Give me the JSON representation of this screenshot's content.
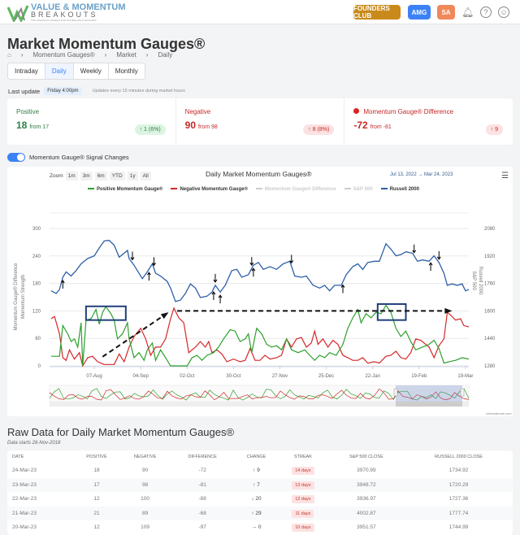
{
  "header": {
    "logo_line1": "VALUE & MOMENTUM",
    "logo_line2": "BREAKOUTS",
    "logo_tagline": "TOP FINANCIAL MODELS FOR DOUBLE-DIGIT SUCCESS",
    "founders": "FOUNDERS CLUB",
    "amg": "AMG",
    "sa": "SA",
    "colors": {
      "founders": "#c98a1b",
      "amg": "#3b82f6",
      "sa": "#f0885a"
    }
  },
  "page": {
    "title": "Market Momentum Gauges®",
    "breadcrumb": [
      "Momentum Gauges®",
      "Market",
      "Daily"
    ],
    "tabs": [
      "Intraday",
      "Daily",
      "Weekly",
      "Monthly"
    ],
    "active_tab": "Daily"
  },
  "update": {
    "label": "Last update",
    "time": "Friday 4:00pm",
    "note": "Updates every 15 minutes during market hours"
  },
  "cards": [
    {
      "label": "Positive",
      "value": "18",
      "from": "from 17",
      "change": "↑ 1 (6%)",
      "color": "#2e7d46"
    },
    {
      "label": "Negative",
      "value": "90",
      "from": "from 98",
      "change": "↑ 8 (8%)",
      "color": "#c62828"
    },
    {
      "label": "Momentum Gauge® Difference",
      "value": "-72",
      "from": "from -81",
      "change": "↑ 9",
      "color": "#c62828"
    }
  ],
  "toggle": {
    "label": "Momentum Gauge® Signal Changes",
    "on": true
  },
  "chart_controls": {
    "zoom_label": "Zoom",
    "zoom": [
      "1m",
      "3m",
      "6m",
      "YTD",
      "1y",
      "All"
    ],
    "from": "Jul 13, 2022",
    "to": "Mar 24, 2023",
    "sep": "→"
  },
  "credit": "vmbreakouts.com",
  "chart_data": {
    "type": "line",
    "title": "Daily Market Momentum Gauges®",
    "legend": [
      {
        "name": "Positive Momentum Gauge®",
        "color": "#2ca02c",
        "visible": true
      },
      {
        "name": "Negative Momentum Gauge®",
        "color": "#d62728",
        "visible": true
      },
      {
        "name": "Momentum Gauge® Difference",
        "color": "#ccc",
        "visible": false
      },
      {
        "name": "S&P 500",
        "color": "#ccc",
        "visible": false
      },
      {
        "name": "Russell 2000",
        "color": "#2e5fa8",
        "visible": true
      }
    ],
    "ylabel_left": "Momentum Gauge® Difference",
    "ylabel_left2": "Momentum Strength",
    "ylabel_right": "S&P 500",
    "ylabel_right2": "Russell 2000",
    "ylim_left": [
      0,
      300
    ],
    "yticks_left": [
      "0",
      "60",
      "120",
      "180",
      "240",
      "300"
    ],
    "ylim_right": [
      1280,
      2080
    ],
    "yticks_right": [
      "1280",
      "1440",
      "1600",
      "1760",
      "1920",
      "2080"
    ],
    "x_unit": "days since Jul 12, 2022",
    "xlim": [
      -1,
      252
    ],
    "xticks": [
      {
        "d": 26,
        "label": "07-Aug"
      },
      {
        "d": 54,
        "label": "04-Sep"
      },
      {
        "d": 82,
        "label": "02-Oct"
      },
      {
        "d": 110,
        "label": "30-Oct"
      },
      {
        "d": 138,
        "label": "27-Nov"
      },
      {
        "d": 166,
        "label": "25-Dec"
      },
      {
        "d": 194,
        "label": "22-Jan"
      },
      {
        "d": 222,
        "label": "19-Feb"
      },
      {
        "d": 250,
        "label": "19-Mar"
      }
    ],
    "russell": [
      [
        0,
        1717
      ],
      [
        3,
        1702
      ],
      [
        5,
        1725
      ],
      [
        7,
        1796
      ],
      [
        9,
        1827
      ],
      [
        12,
        1803
      ],
      [
        15,
        1835
      ],
      [
        18,
        1874
      ],
      [
        22,
        1905
      ],
      [
        26,
        1921
      ],
      [
        29,
        1967
      ],
      [
        32,
        2007
      ],
      [
        35,
        2011
      ],
      [
        38,
        1983
      ],
      [
        41,
        1913
      ],
      [
        44,
        1936
      ],
      [
        46,
        1952
      ],
      [
        47,
        1905
      ],
      [
        50,
        1866
      ],
      [
        55,
        1788
      ],
      [
        58,
        1827
      ],
      [
        61,
        1874
      ],
      [
        63,
        1819
      ],
      [
        66,
        1803
      ],
      [
        70,
        1772
      ],
      [
        72,
        1733
      ],
      [
        75,
        1655
      ],
      [
        78,
        1663
      ],
      [
        81,
        1702
      ],
      [
        84,
        1757
      ],
      [
        87,
        1733
      ],
      [
        90,
        1678
      ],
      [
        94,
        1686
      ],
      [
        97,
        1710
      ],
      [
        99,
        1749
      ],
      [
        102,
        1710
      ],
      [
        105,
        1749
      ],
      [
        109,
        1835
      ],
      [
        112,
        1842
      ],
      [
        115,
        1796
      ],
      [
        119,
        1811
      ],
      [
        122,
        1866
      ],
      [
        125,
        1882
      ],
      [
        128,
        1842
      ],
      [
        132,
        1858
      ],
      [
        136,
        1842
      ],
      [
        140,
        1874
      ],
      [
        144,
        1889
      ],
      [
        147,
        1803
      ],
      [
        151,
        1796
      ],
      [
        154,
        1803
      ],
      [
        158,
        1749
      ],
      [
        162,
        1733
      ],
      [
        165,
        1749
      ],
      [
        168,
        1717
      ],
      [
        171,
        1749
      ],
      [
        175,
        1749
      ],
      [
        178,
        1811
      ],
      [
        182,
        1858
      ],
      [
        185,
        1874
      ],
      [
        188,
        1842
      ],
      [
        191,
        1882
      ],
      [
        195,
        1889
      ],
      [
        198,
        1889
      ],
      [
        202,
        1991
      ],
      [
        205,
        1960
      ],
      [
        208,
        1921
      ],
      [
        211,
        1928
      ],
      [
        214,
        1944
      ],
      [
        218,
        1936
      ],
      [
        221,
        1889
      ],
      [
        224,
        1897
      ],
      [
        228,
        1889
      ],
      [
        231,
        1921
      ],
      [
        234,
        1882
      ],
      [
        237,
        1819
      ],
      [
        239,
        1749
      ],
      [
        242,
        1757
      ],
      [
        245,
        1749
      ],
      [
        248,
        1757
      ],
      [
        250,
        1717
      ],
      [
        252,
        1725
      ]
    ],
    "positive": [
      [
        0,
        21
      ],
      [
        5,
        21
      ],
      [
        7,
        88
      ],
      [
        10,
        70
      ],
      [
        12,
        53
      ],
      [
        14,
        59
      ],
      [
        16,
        41
      ],
      [
        18,
        94
      ],
      [
        19,
        0
      ],
      [
        21,
        100
      ],
      [
        24,
        103
      ],
      [
        27,
        123
      ],
      [
        29,
        91
      ],
      [
        31,
        117
      ],
      [
        33,
        129
      ],
      [
        36,
        114
      ],
      [
        38,
        100
      ],
      [
        40,
        59
      ],
      [
        43,
        70
      ],
      [
        46,
        94
      ],
      [
        47,
        59
      ],
      [
        50,
        18
      ],
      [
        53,
        29
      ],
      [
        56,
        12
      ],
      [
        58,
        35
      ],
      [
        61,
        50
      ],
      [
        63,
        12
      ],
      [
        66,
        35
      ],
      [
        70,
        12
      ],
      [
        72,
        0
      ],
      [
        78,
        0
      ],
      [
        82,
        0
      ],
      [
        85,
        18
      ],
      [
        88,
        23
      ],
      [
        91,
        12
      ],
      [
        94,
        23
      ],
      [
        98,
        29
      ],
      [
        101,
        41
      ],
      [
        104,
        59
      ],
      [
        108,
        79
      ],
      [
        111,
        76
      ],
      [
        114,
        53
      ],
      [
        117,
        59
      ],
      [
        119,
        70
      ],
      [
        121,
        29
      ],
      [
        124,
        82
      ],
      [
        127,
        70
      ],
      [
        130,
        47
      ],
      [
        133,
        41
      ],
      [
        136,
        44
      ],
      [
        139,
        35
      ],
      [
        142,
        59
      ],
      [
        145,
        35
      ],
      [
        149,
        29
      ],
      [
        153,
        35
      ],
      [
        156,
        23
      ],
      [
        159,
        12
      ],
      [
        162,
        23
      ],
      [
        165,
        18
      ],
      [
        168,
        29
      ],
      [
        172,
        23
      ],
      [
        176,
        47
      ],
      [
        179,
        82
      ],
      [
        182,
        105
      ],
      [
        185,
        123
      ],
      [
        187,
        94
      ],
      [
        190,
        114
      ],
      [
        193,
        105
      ],
      [
        196,
        117
      ],
      [
        199,
        114
      ],
      [
        202,
        132
      ],
      [
        205,
        117
      ],
      [
        208,
        82
      ],
      [
        211,
        64
      ],
      [
        214,
        76
      ],
      [
        217,
        53
      ],
      [
        220,
        35
      ],
      [
        224,
        41
      ],
      [
        228,
        47
      ],
      [
        231,
        56
      ],
      [
        234,
        38
      ],
      [
        237,
        6
      ],
      [
        240,
        9
      ],
      [
        244,
        12
      ],
      [
        248,
        18
      ],
      [
        252,
        15
      ]
    ],
    "negative": [
      [
        0,
        103
      ],
      [
        2,
        108
      ],
      [
        5,
        70
      ],
      [
        7,
        18
      ],
      [
        9,
        12
      ],
      [
        11,
        35
      ],
      [
        14,
        15
      ],
      [
        17,
        29
      ],
      [
        19,
        0
      ],
      [
        22,
        18
      ],
      [
        25,
        21
      ],
      [
        28,
        9
      ],
      [
        32,
        3
      ],
      [
        38,
        3
      ],
      [
        41,
        26
      ],
      [
        44,
        9
      ],
      [
        47,
        41
      ],
      [
        50,
        64
      ],
      [
        54,
        82
      ],
      [
        57,
        59
      ],
      [
        60,
        23
      ],
      [
        63,
        41
      ],
      [
        66,
        41
      ],
      [
        69,
        59
      ],
      [
        72,
        103
      ],
      [
        74,
        126
      ],
      [
        77,
        105
      ],
      [
        80,
        94
      ],
      [
        83,
        29
      ],
      [
        87,
        41
      ],
      [
        90,
        53
      ],
      [
        93,
        41
      ],
      [
        95,
        53
      ],
      [
        97,
        29
      ],
      [
        100,
        35
      ],
      [
        103,
        26
      ],
      [
        106,
        9
      ],
      [
        110,
        15
      ],
      [
        114,
        9
      ],
      [
        117,
        12
      ],
      [
        120,
        38
      ],
      [
        123,
        12
      ],
      [
        126,
        12
      ],
      [
        129,
        23
      ],
      [
        132,
        15
      ],
      [
        136,
        18
      ],
      [
        139,
        23
      ],
      [
        142,
        59
      ],
      [
        145,
        41
      ],
      [
        148,
        59
      ],
      [
        151,
        62
      ],
      [
        154,
        41
      ],
      [
        157,
        50
      ],
      [
        159,
        76
      ],
      [
        161,
        47
      ],
      [
        164,
        59
      ],
      [
        167,
        41
      ],
      [
        170,
        56
      ],
      [
        173,
        47
      ],
      [
        176,
        23
      ],
      [
        179,
        18
      ],
      [
        182,
        12
      ],
      [
        185,
        12
      ],
      [
        188,
        18
      ],
      [
        191,
        6
      ],
      [
        195,
        9
      ],
      [
        198,
        6
      ],
      [
        202,
        21
      ],
      [
        205,
        23
      ],
      [
        208,
        32
      ],
      [
        211,
        18
      ],
      [
        214,
        15
      ],
      [
        217,
        29
      ],
      [
        220,
        59
      ],
      [
        223,
        56
      ],
      [
        226,
        47
      ],
      [
        228,
        41
      ],
      [
        231,
        18
      ],
      [
        234,
        44
      ],
      [
        237,
        59
      ],
      [
        239,
        117
      ],
      [
        241,
        111
      ],
      [
        244,
        100
      ],
      [
        247,
        103
      ],
      [
        249,
        88
      ],
      [
        252,
        85
      ]
    ],
    "signals": [
      {
        "d": 7,
        "dir": "up"
      },
      {
        "d": 49,
        "dir": "down"
      },
      {
        "d": 59,
        "dir": "up"
      },
      {
        "d": 62,
        "dir": "down"
      },
      {
        "d": 98,
        "dir": "up"
      },
      {
        "d": 99,
        "dir": "down"
      },
      {
        "d": 102,
        "dir": "up"
      },
      {
        "d": 121,
        "dir": "down"
      },
      {
        "d": 122,
        "dir": "up"
      },
      {
        "d": 145,
        "dir": "down"
      },
      {
        "d": 176,
        "dir": "up"
      },
      {
        "d": 219,
        "dir": "down"
      },
      {
        "d": 229,
        "dir": "up"
      },
      {
        "d": 234,
        "dir": "down"
      }
    ],
    "annotations": {
      "boxes": [
        {
          "d0": 21,
          "d1": 45,
          "v0": 100,
          "v1": 130
        },
        {
          "d0": 197,
          "d1": 214,
          "v0": 100,
          "v1": 135
        }
      ],
      "arrows": [
        {
          "d0": 31,
          "v0": 20,
          "d1": 70,
          "v1": 115
        },
        {
          "d0": 76,
          "v0": 120,
          "d1": 241,
          "v1": 120
        }
      ]
    }
  },
  "table": {
    "title": "Raw Data for Daily Market Momentum Gauges®",
    "subtitle": "Data starts 26-Nov-2018",
    "columns": [
      "DATE",
      "POSITIVE",
      "NEGATIVE",
      "DIFFERENCE",
      "CHANGE",
      "STREAK",
      "S&P 500 CLOSE",
      "RUSSELL 2000 CLOSE"
    ],
    "rows": [
      [
        "24-Mar-23",
        "18",
        "90",
        "-72",
        "↑ 9",
        "14 days",
        "3970.99",
        "1734.92"
      ],
      [
        "23-Mar-23",
        "17",
        "98",
        "-81",
        "↑ 7",
        "13 days",
        "3948.72",
        "1720.29"
      ],
      [
        "22-Mar-23",
        "12",
        "100",
        "-88",
        "↓ 20",
        "12 days",
        "3936.97",
        "1727.36"
      ],
      [
        "21-Mar-23",
        "21",
        "89",
        "-68",
        "↑ 29",
        "11 days",
        "4002.87",
        "1777.74"
      ],
      [
        "20-Mar-23",
        "12",
        "109",
        "-97",
        "→ 0",
        "10 days",
        "3951.57",
        "1744.99"
      ]
    ]
  }
}
